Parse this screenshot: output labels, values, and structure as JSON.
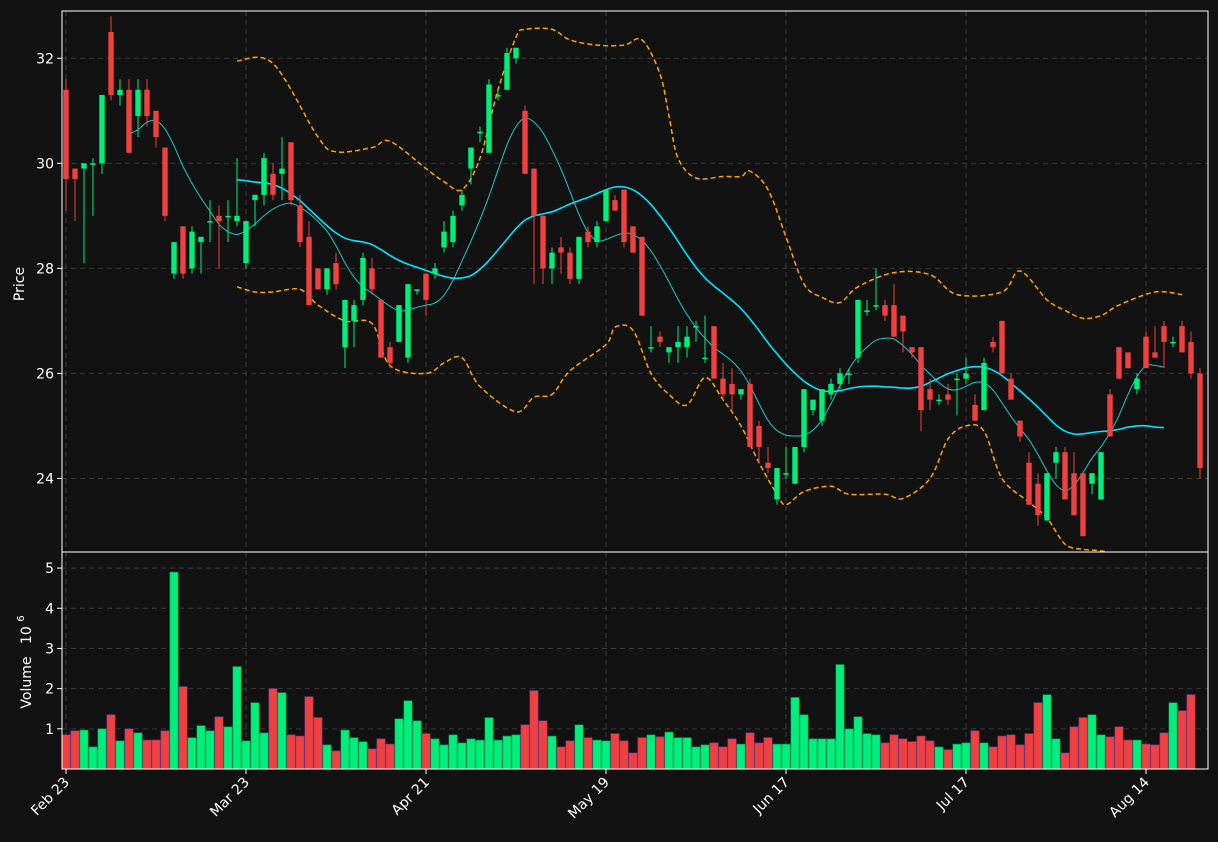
{
  "colors": {
    "background": "#121212",
    "up": "#00ee7a",
    "down": "#f04040",
    "ma_fast": "#20c8c8",
    "ma_slow": "#00e5ff",
    "bands": "#ffa500",
    "grid": "#3a3a3a",
    "text": "#ffffff"
  },
  "chart_data": {
    "type": "candlestick",
    "panels": [
      "price",
      "volume"
    ],
    "ylabel_price": "Price",
    "ylabel_volume": "Volume",
    "volume_multiplier": "10",
    "volume_exponent": "6",
    "xtick_labels": [
      {
        "label": "Feb 23",
        "index": 0
      },
      {
        "label": "Mar 23",
        "index": 20
      },
      {
        "label": "Apr 21",
        "index": 40
      },
      {
        "label": "May 19",
        "index": 60
      },
      {
        "label": "Jun 17",
        "index": 80
      },
      {
        "label": "Jul 17",
        "index": 100
      },
      {
        "label": "Aug 14",
        "index": 120
      }
    ],
    "price_ylim": [
      22.6,
      32.9
    ],
    "price_yticks": [
      "24",
      "26",
      "28",
      "30",
      "32"
    ],
    "volume_ylim": [
      0.0,
      5.4
    ],
    "volume_yticks": [
      "1",
      "2",
      "3",
      "4",
      "5"
    ],
    "grid": true,
    "ma_fast_window": 8,
    "ma_slow_window": 20,
    "close": [
      29.7,
      29.7,
      30.0,
      30.0,
      31.3,
      31.3,
      31.4,
      30.2,
      31.4,
      30.9,
      30.5,
      29.0,
      28.0,
      27.9,
      28.7,
      28.6,
      28.9,
      29.0,
      29.0,
      29.0,
      28.2,
      29.4,
      30.1,
      29.4,
      29.8,
      29.3,
      28.5,
      27.3,
      27.6,
      28.0,
      27.7,
      26.5,
      27.3,
      28.2,
      27.6,
      26.5,
      26.2,
      27.3,
      27.7,
      27.6,
      27.4,
      28.0,
      28.7,
      29.1,
      29.4,
      30.3,
      30.6,
      31.5,
      31.3,
      32.1,
      32.2,
      29.9,
      29.0,
      28.0,
      28.4,
      28.3,
      27.8,
      28.6,
      28.7,
      28.9,
      29.5,
      29.1,
      28.5,
      28.3,
      27.1,
      26.5,
      26.7,
      26.4,
      26.5,
      26.7,
      26.9,
      26.3,
      25.9,
      25.5,
      25.8,
      25.1,
      24.2,
      23.6,
      24.1,
      24.6,
      25.7,
      25.3,
      25.8,
      25.7,
      25.9,
      26.0,
      27.4,
      27.2,
      27.3,
      27.0,
      26.6,
      26.4,
      25.3,
      25.5,
      25.5,
      25.6,
      25.9,
      25.9,
      25.1,
      26.2,
      26.6,
      26.0,
      25.5,
      24.8,
      23.5,
      23.2,
      24.1,
      24.3,
      24.4,
      23.3,
      22.9,
      23.8,
      24.5,
      25.6,
      26.5,
      26.0,
      25.6,
      26.7,
      26.3,
      26.6,
      26.4,
      26.0,
      24.2
    ],
    "candles": [
      [
        31.4,
        31.6,
        29.1,
        29.7
      ],
      [
        29.9,
        29.9,
        28.9,
        29.7
      ],
      [
        29.9,
        30.0,
        28.1,
        30.0
      ],
      [
        30.0,
        30.1,
        29.0,
        30.0
      ],
      [
        30.0,
        31.3,
        29.8,
        31.3
      ],
      [
        32.5,
        32.8,
        31.2,
        31.3
      ],
      [
        31.3,
        31.6,
        31.1,
        31.4
      ],
      [
        31.4,
        31.6,
        30.2,
        30.2
      ],
      [
        30.9,
        31.6,
        30.5,
        31.4
      ],
      [
        31.4,
        31.6,
        30.7,
        30.9
      ],
      [
        31.0,
        31.0,
        30.3,
        30.5
      ],
      [
        30.3,
        30.3,
        28.9,
        29.0
      ],
      [
        27.9,
        28.5,
        27.8,
        28.5
      ],
      [
        28.8,
        28.8,
        27.8,
        27.9
      ],
      [
        28.0,
        28.8,
        27.9,
        28.7
      ],
      [
        28.5,
        28.6,
        27.9,
        28.6
      ],
      [
        28.9,
        29.3,
        28.5,
        28.9
      ],
      [
        29.0,
        29.2,
        28.0,
        28.9
      ],
      [
        29.0,
        29.3,
        28.5,
        29.0
      ],
      [
        28.9,
        30.1,
        28.8,
        29.0
      ],
      [
        28.1,
        28.9,
        28.0,
        28.9
      ],
      [
        29.3,
        29.4,
        28.8,
        29.4
      ],
      [
        29.4,
        30.2,
        29.2,
        30.1
      ],
      [
        29.8,
        30.0,
        29.3,
        29.4
      ],
      [
        29.8,
        30.5,
        29.3,
        29.9
      ],
      [
        30.4,
        30.4,
        29.2,
        29.3
      ],
      [
        29.2,
        29.4,
        28.4,
        28.5
      ],
      [
        28.6,
        28.9,
        27.3,
        27.3
      ],
      [
        28.0,
        28.0,
        27.6,
        27.6
      ],
      [
        27.6,
        28.0,
        27.5,
        28.0
      ],
      [
        28.1,
        28.3,
        27.6,
        27.7
      ],
      [
        26.5,
        27.4,
        26.1,
        27.4
      ],
      [
        27.0,
        27.4,
        26.5,
        27.3
      ],
      [
        27.4,
        28.3,
        27.3,
        28.2
      ],
      [
        28.0,
        28.2,
        27.5,
        27.6
      ],
      [
        27.4,
        27.4,
        26.3,
        26.3
      ],
      [
        26.5,
        26.6,
        26.1,
        26.2
      ],
      [
        26.6,
        27.3,
        26.6,
        27.3
      ],
      [
        26.3,
        27.7,
        26.2,
        27.7
      ],
      [
        27.6,
        27.6,
        27.5,
        27.6
      ],
      [
        27.9,
        27.9,
        27.1,
        27.4
      ],
      [
        27.9,
        28.1,
        27.8,
        28.0
      ],
      [
        28.4,
        28.9,
        28.3,
        28.7
      ],
      [
        28.5,
        29.1,
        28.4,
        29.0
      ],
      [
        29.2,
        29.5,
        29.1,
        29.4
      ],
      [
        29.9,
        30.3,
        29.6,
        30.3
      ],
      [
        30.6,
        30.7,
        30.4,
        30.6
      ],
      [
        30.2,
        31.6,
        30.2,
        31.5
      ],
      [
        31.3,
        31.4,
        31.2,
        31.3
      ],
      [
        31.4,
        32.2,
        31.4,
        32.1
      ],
      [
        32.0,
        32.2,
        31.9,
        32.2
      ],
      [
        31.0,
        31.1,
        29.8,
        29.8
      ],
      [
        29.9,
        29.9,
        27.7,
        29.0
      ],
      [
        29.0,
        29.0,
        27.7,
        28.0
      ],
      [
        28.0,
        28.4,
        27.7,
        28.3
      ],
      [
        28.4,
        28.6,
        27.9,
        28.3
      ],
      [
        28.3,
        28.4,
        27.7,
        27.8
      ],
      [
        27.8,
        28.6,
        27.7,
        28.6
      ],
      [
        28.7,
        28.8,
        28.4,
        28.5
      ],
      [
        28.5,
        28.9,
        28.4,
        28.8
      ],
      [
        28.9,
        29.5,
        28.9,
        29.5
      ],
      [
        29.3,
        29.4,
        29.1,
        29.1
      ],
      [
        29.5,
        29.5,
        28.4,
        28.5
      ],
      [
        28.8,
        28.8,
        28.3,
        28.3
      ],
      [
        28.6,
        28.6,
        27.1,
        27.1
      ],
      [
        26.5,
        26.9,
        26.4,
        26.5
      ],
      [
        26.7,
        26.8,
        26.5,
        26.6
      ],
      [
        26.4,
        26.5,
        26.2,
        26.5
      ],
      [
        26.5,
        26.9,
        26.2,
        26.6
      ],
      [
        26.5,
        26.9,
        26.3,
        26.7
      ],
      [
        26.9,
        27.0,
        26.6,
        26.9
      ],
      [
        26.3,
        27.1,
        26.2,
        26.3
      ],
      [
        26.9,
        26.9,
        25.9,
        25.9
      ],
      [
        25.9,
        26.2,
        25.5,
        25.6
      ],
      [
        25.8,
        26.1,
        25.3,
        25.6
      ],
      [
        25.6,
        25.7,
        25.5,
        25.7
      ],
      [
        25.8,
        25.9,
        24.6,
        24.6
      ],
      [
        25.0,
        25.1,
        24.3,
        24.6
      ],
      [
        24.3,
        24.6,
        24.1,
        24.2
      ],
      [
        23.6,
        24.2,
        23.5,
        24.2
      ],
      [
        24.1,
        24.6,
        24.0,
        24.1
      ],
      [
        23.9,
        24.6,
        23.9,
        24.6
      ],
      [
        24.6,
        25.7,
        24.5,
        25.7
      ],
      [
        25.3,
        25.5,
        25.2,
        25.5
      ],
      [
        25.1,
        25.7,
        25.0,
        25.7
      ],
      [
        25.6,
        25.9,
        25.5,
        25.8
      ],
      [
        25.8,
        26.1,
        25.7,
        26.0
      ],
      [
        26.0,
        26.1,
        25.8,
        26.0
      ],
      [
        26.3,
        27.4,
        26.2,
        27.4
      ],
      [
        27.2,
        27.4,
        27.1,
        27.2
      ],
      [
        27.3,
        28.0,
        27.2,
        27.3
      ],
      [
        27.3,
        27.4,
        27.0,
        27.1
      ],
      [
        27.3,
        27.7,
        26.7,
        26.7
      ],
      [
        27.1,
        27.1,
        26.4,
        26.8
      ],
      [
        26.5,
        26.5,
        26.3,
        26.4
      ],
      [
        26.5,
        26.5,
        24.9,
        25.3
      ],
      [
        25.7,
        25.9,
        25.3,
        25.5
      ],
      [
        25.5,
        25.6,
        25.4,
        25.5
      ],
      [
        25.6,
        25.8,
        25.4,
        25.5
      ],
      [
        25.9,
        26.0,
        25.2,
        25.9
      ],
      [
        25.9,
        26.3,
        25.8,
        26.0
      ],
      [
        25.4,
        25.6,
        25.1,
        25.1
      ],
      [
        25.3,
        26.3,
        25.3,
        26.2
      ],
      [
        26.6,
        26.7,
        26.4,
        26.5
      ],
      [
        27.0,
        27.0,
        26.0,
        26.0
      ],
      [
        25.9,
        26.0,
        25.5,
        25.5
      ],
      [
        25.1,
        25.1,
        24.7,
        24.8
      ],
      [
        24.3,
        24.5,
        23.5,
        23.5
      ],
      [
        23.9,
        24.1,
        23.1,
        23.3
      ],
      [
        23.2,
        24.1,
        23.2,
        24.1
      ],
      [
        24.3,
        24.6,
        24.0,
        24.5
      ],
      [
        24.5,
        24.6,
        23.6,
        23.6
      ],
      [
        24.1,
        24.5,
        23.3,
        23.3
      ],
      [
        24.1,
        24.1,
        22.9,
        22.9
      ],
      [
        23.9,
        24.1,
        23.7,
        24.1
      ],
      [
        23.6,
        24.5,
        23.6,
        24.5
      ],
      [
        25.6,
        25.7,
        24.8,
        24.8
      ],
      [
        26.5,
        26.5,
        25.9,
        25.9
      ],
      [
        26.4,
        26.4,
        26.1,
        26.1
      ],
      [
        25.7,
        26.0,
        25.6,
        25.9
      ],
      [
        26.7,
        26.8,
        26.1,
        26.1
      ],
      [
        26.4,
        26.9,
        26.3,
        26.3
      ],
      [
        26.9,
        27.0,
        26.1,
        26.6
      ],
      [
        26.6,
        26.7,
        26.5,
        26.6
      ],
      [
        26.9,
        27.0,
        26.4,
        26.4
      ],
      [
        26.6,
        26.8,
        25.9,
        26.0
      ],
      [
        26.0,
        26.1,
        24.0,
        24.2
      ]
    ],
    "volume": [
      0.85,
      0.95,
      0.97,
      0.55,
      1.0,
      1.35,
      0.7,
      1.0,
      0.9,
      0.72,
      0.72,
      0.95,
      4.9,
      2.05,
      0.78,
      1.08,
      0.95,
      1.3,
      1.05,
      2.55,
      0.7,
      1.65,
      0.9,
      2.0,
      1.9,
      0.85,
      0.82,
      1.8,
      1.28,
      0.6,
      0.45,
      0.97,
      0.78,
      0.68,
      0.5,
      0.75,
      0.62,
      1.25,
      1.7,
      1.2,
      0.88,
      0.75,
      0.6,
      0.85,
      0.65,
      0.75,
      0.72,
      1.28,
      0.72,
      0.82,
      0.85,
      1.1,
      1.95,
      1.2,
      0.82,
      0.55,
      0.7,
      1.1,
      0.78,
      0.72,
      0.7,
      0.88,
      0.7,
      0.4,
      0.78,
      0.85,
      0.8,
      0.92,
      0.78,
      0.78,
      0.55,
      0.6,
      0.65,
      0.55,
      0.75,
      0.62,
      0.9,
      0.65,
      0.78,
      0.62,
      0.62,
      1.78,
      1.35,
      0.75,
      0.75,
      0.75,
      2.6,
      1.0,
      1.3,
      0.88,
      0.85,
      0.65,
      0.85,
      0.75,
      0.68,
      0.82,
      0.7,
      0.55,
      0.48,
      0.62,
      0.65,
      0.95,
      0.65,
      0.55,
      0.82,
      0.85,
      0.6,
      0.88,
      1.65,
      1.85,
      0.75,
      0.4,
      1.05,
      1.28,
      1.35,
      0.85,
      0.8,
      1.05,
      0.72,
      0.72,
      0.62,
      0.6,
      0.9,
      1.65,
      1.45,
      1.85
    ],
    "band_upper": [
      {
        "i": 19,
        "v": 31.95
      },
      {
        "i": 23,
        "v": 31.9
      },
      {
        "i": 28,
        "v": 30.5
      },
      {
        "i": 30,
        "v": 30.22
      },
      {
        "i": 34,
        "v": 30.3
      },
      {
        "i": 36,
        "v": 30.42
      },
      {
        "i": 40,
        "v": 29.9
      },
      {
        "i": 42,
        "v": 29.65
      },
      {
        "i": 44,
        "v": 29.5
      },
      {
        "i": 46,
        "v": 30.1
      },
      {
        "i": 48,
        "v": 31.4
      },
      {
        "i": 50,
        "v": 32.4
      },
      {
        "i": 51,
        "v": 32.55
      },
      {
        "i": 54,
        "v": 32.55
      },
      {
        "i": 56,
        "v": 32.35
      },
      {
        "i": 59,
        "v": 32.25
      },
      {
        "i": 62,
        "v": 32.25
      },
      {
        "i": 64,
        "v": 32.35
      },
      {
        "i": 66,
        "v": 31.7
      },
      {
        "i": 67,
        "v": 30.9
      },
      {
        "i": 68,
        "v": 30.1
      },
      {
        "i": 70,
        "v": 29.72
      },
      {
        "i": 73,
        "v": 29.75
      },
      {
        "i": 75,
        "v": 29.75
      },
      {
        "i": 76,
        "v": 29.85
      },
      {
        "i": 78,
        "v": 29.5
      },
      {
        "i": 80,
        "v": 28.6
      },
      {
        "i": 82,
        "v": 27.7
      },
      {
        "i": 84,
        "v": 27.45
      },
      {
        "i": 86,
        "v": 27.35
      },
      {
        "i": 88,
        "v": 27.65
      },
      {
        "i": 92,
        "v": 27.92
      },
      {
        "i": 96,
        "v": 27.88
      },
      {
        "i": 99,
        "v": 27.5
      },
      {
        "i": 104,
        "v": 27.55
      },
      {
        "i": 106,
        "v": 27.95
      },
      {
        "i": 109,
        "v": 27.4
      },
      {
        "i": 111,
        "v": 27.2
      },
      {
        "i": 113,
        "v": 27.05
      },
      {
        "i": 115,
        "v": 27.1
      },
      {
        "i": 117,
        "v": 27.3
      },
      {
        "i": 121,
        "v": 27.55
      },
      {
        "i": 124,
        "v": 27.5
      }
    ],
    "band_lower": [
      {
        "i": 19,
        "v": 27.65
      },
      {
        "i": 21,
        "v": 27.55
      },
      {
        "i": 23,
        "v": 27.55
      },
      {
        "i": 26,
        "v": 27.6
      },
      {
        "i": 28,
        "v": 27.3
      },
      {
        "i": 31,
        "v": 27.0
      },
      {
        "i": 34,
        "v": 26.95
      },
      {
        "i": 36,
        "v": 26.15
      },
      {
        "i": 40,
        "v": 26.0
      },
      {
        "i": 42,
        "v": 26.2
      },
      {
        "i": 44,
        "v": 26.3
      },
      {
        "i": 46,
        "v": 25.75
      },
      {
        "i": 50,
        "v": 25.27
      },
      {
        "i": 52,
        "v": 25.55
      },
      {
        "i": 54,
        "v": 25.6
      },
      {
        "i": 56,
        "v": 26.05
      },
      {
        "i": 60,
        "v": 26.55
      },
      {
        "i": 61,
        "v": 26.88
      },
      {
        "i": 63,
        "v": 26.82
      },
      {
        "i": 65,
        "v": 26.0
      },
      {
        "i": 67,
        "v": 25.6
      },
      {
        "i": 69,
        "v": 25.4
      },
      {
        "i": 71,
        "v": 25.92
      },
      {
        "i": 73,
        "v": 25.5
      },
      {
        "i": 75,
        "v": 25.0
      },
      {
        "i": 77,
        "v": 24.3
      },
      {
        "i": 79,
        "v": 23.7
      },
      {
        "i": 80,
        "v": 23.5
      },
      {
        "i": 82,
        "v": 23.75
      },
      {
        "i": 85,
        "v": 23.85
      },
      {
        "i": 87,
        "v": 23.7
      },
      {
        "i": 91,
        "v": 23.7
      },
      {
        "i": 93,
        "v": 23.62
      },
      {
        "i": 96,
        "v": 24.0
      },
      {
        "i": 98,
        "v": 24.75
      },
      {
        "i": 100,
        "v": 25.0
      },
      {
        "i": 102,
        "v": 24.9
      },
      {
        "i": 104,
        "v": 24.0
      },
      {
        "i": 107,
        "v": 23.55
      },
      {
        "i": 109,
        "v": 23.25
      },
      {
        "i": 111,
        "v": 22.75
      },
      {
        "i": 113,
        "v": 22.65
      },
      {
        "i": 115,
        "v": 22.62
      },
      {
        "i": 118,
        "v": 22.5
      },
      {
        "i": 121,
        "v": 22.4
      }
    ]
  }
}
